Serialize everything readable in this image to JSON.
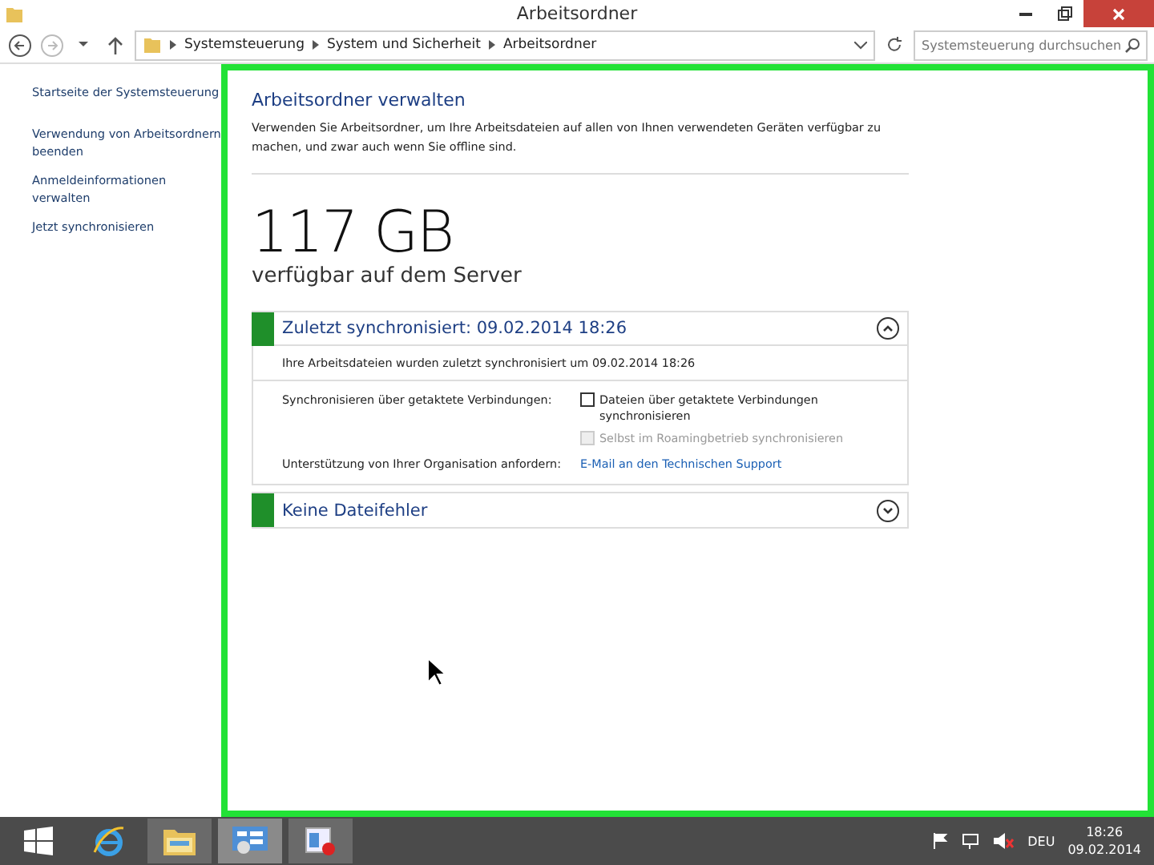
{
  "window": {
    "title": "Arbeitsordner"
  },
  "address_bar": {
    "path": [
      "Systemsteuerung",
      "System und Sicherheit",
      "Arbeitsordner"
    ],
    "search_placeholder": "Systemsteuerung durchsuchen"
  },
  "sidebar": {
    "items": [
      {
        "label": "Startseite der Systemsteuerung"
      },
      {
        "label": "Verwendung von Arbeitsordnern beenden"
      },
      {
        "label": "Anmeldeinformationen verwalten"
      },
      {
        "label": "Jetzt synchronisieren"
      }
    ]
  },
  "content": {
    "heading": "Arbeitsordner verwalten",
    "description": "Verwenden Sie Arbeitsordner, um Ihre Arbeitsdateien auf allen von Ihnen verwendeten Geräten verfügbar zu machen, und zwar auch wenn Sie offline sind.",
    "capacity": "117 GB",
    "capacity_label": "verfügbar auf dem Server",
    "sections": [
      {
        "title": "Zuletzt synchronisiert: 09.02.2014 18:26",
        "color": "#1f8f2a",
        "expanded": true,
        "summary": "Ihre Arbeitsdateien wurden zuletzt synchronisiert um 09.02.2014 18:26",
        "metered_label": "Synchronisieren über getaktete Verbindungen:",
        "options": [
          {
            "label": "Dateien über getaktete Verbindungen synchronisieren",
            "checked": false,
            "disabled": false
          },
          {
            "label": "Selbst im Roamingbetrieb synchronisieren",
            "checked": false,
            "disabled": true
          }
        ],
        "support_label": "Unterstützung von Ihrer Organisation anfordern:",
        "support_link": "E-Mail an den Technischen Support"
      },
      {
        "title": "Keine Dateifehler",
        "color": "#1f8f2a",
        "expanded": false
      }
    ]
  },
  "taskbar": {
    "apps": [
      {
        "selected": false
      },
      {
        "selected": false
      },
      {
        "selected": true
      },
      {
        "selected": false
      }
    ],
    "language": "DEU",
    "time": "18:26",
    "date": "09.02.2014"
  }
}
